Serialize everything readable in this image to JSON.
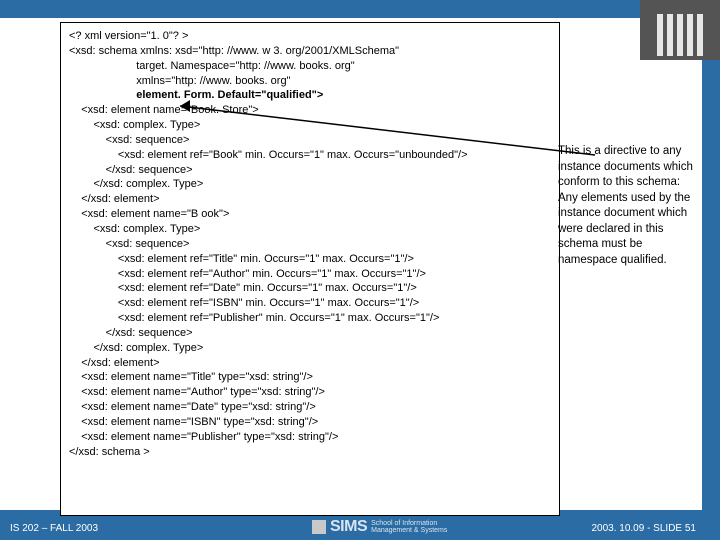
{
  "footer": {
    "left": "IS 202 – FALL 2003",
    "right": "2003. 10.09 - SLIDE 51",
    "logo_big": "SIMS",
    "logo_line1": "School of Information",
    "logo_line2": "Management & Systems"
  },
  "annotation": {
    "text": "This is a directive to any instance documents which conform to this schema: Any elements used by the instance document which were declared in  this schema must be namespace qualified."
  },
  "code": {
    "l01": "<? xml version=\"1. 0\"? >",
    "l02": "<xsd: schema xmlns: xsd=\"http: //www. w 3. org/2001/XMLSchema\"",
    "l03": "                      target. Namespace=\"http: //www. books. org\"",
    "l04": "                      xmlns=\"http: //www. books. org\"",
    "l05": "                      element. Form. Default=\"qualified\">",
    "l06": "    <xsd: element name=\"Book. Store\">",
    "l07": "        <xsd: complex. Type>",
    "l08": "            <xsd: sequence>",
    "l09": "                <xsd: element ref=\"Book\" min. Occurs=\"1\" max. Occurs=\"unbounded\"/>",
    "l10": "            </xsd: sequence>",
    "l11": "        </xsd: complex. Type>",
    "l12": "    </xsd: element>",
    "l13": "    <xsd: element name=\"B ook\">",
    "l14": "        <xsd: complex. Type>",
    "l15": "            <xsd: sequence>",
    "l16": "                <xsd: element ref=\"Title\" min. Occurs=\"1\" max. Occurs=\"1\"/>",
    "l17": "                <xsd: element ref=\"Author\" min. Occurs=\"1\" max. Occurs=\"1\"/>",
    "l18": "                <xsd: element ref=\"Date\" min. Occurs=\"1\" max. Occurs=\"1\"/>",
    "l19": "                <xsd: element ref=\"ISBN\" min. Occurs=\"1\" max. Occurs=\"1\"/>",
    "l20": "                <xsd: element ref=\"Publisher\" min. Occurs=\"1\" max. Occurs=\"1\"/>",
    "l21": "            </xsd: sequence>",
    "l22": "        </xsd: complex. Type>",
    "l23": "    </xsd: element>",
    "l24": "    <xsd: element name=\"Title\" type=\"xsd: string\"/>",
    "l25": "    <xsd: element name=\"Author\" type=\"xsd: string\"/>",
    "l26": "    <xsd: element name=\"Date\" type=\"xsd: string\"/>",
    "l27": "    <xsd: element name=\"ISBN\" type=\"xsd: string\"/>",
    "l28": "    <xsd: element name=\"Publisher\" type=\"xsd: string\"/>",
    "l29": "</xsd: schema >"
  }
}
